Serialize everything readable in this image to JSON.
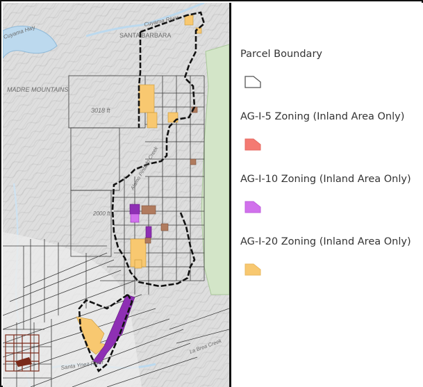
{
  "map": {
    "place_labels": {
      "city": "SANTA BARBARA",
      "mountains": "MADRE MOUNTAINS",
      "peak_elevation": "3018 ft",
      "contour_elevation": "2000 ft",
      "river_north": "Cuyama River",
      "river_south": "Santa Ynez River",
      "highway": "Cuyama Hwy",
      "creek_north": "Alamo Pintado Creek",
      "creek_south": "La Brea Creek"
    }
  },
  "legend": {
    "items": [
      {
        "label": "Parcel Boundary",
        "symbol": "parcel-outline",
        "color": "#ffffff"
      },
      {
        "label": "AG-I-5 Zoning (Inland Area Only)",
        "symbol": "fill",
        "color": "#f47a72"
      },
      {
        "label": "AG-I-10 Zoning (Inland Area Only)",
        "symbol": "fill",
        "color": "#d171ec"
      },
      {
        "label": "AG-I-20 Zoning (Inland Area Only)",
        "symbol": "fill",
        "color": "#f8c870"
      }
    ]
  },
  "colors": {
    "terrain": "#dedede",
    "water": "#bcd9ee",
    "forest": "#d3e5c8",
    "parcel_line": "#2a2a2a",
    "boundary": "#111111",
    "ag_i_5": "#f47a72",
    "ag_i_10": "#d171ec",
    "ag_i_10_dark": "#8e2fb4",
    "ag_i_20": "#f8c870",
    "brown_parcels": "#b07b5e"
  }
}
